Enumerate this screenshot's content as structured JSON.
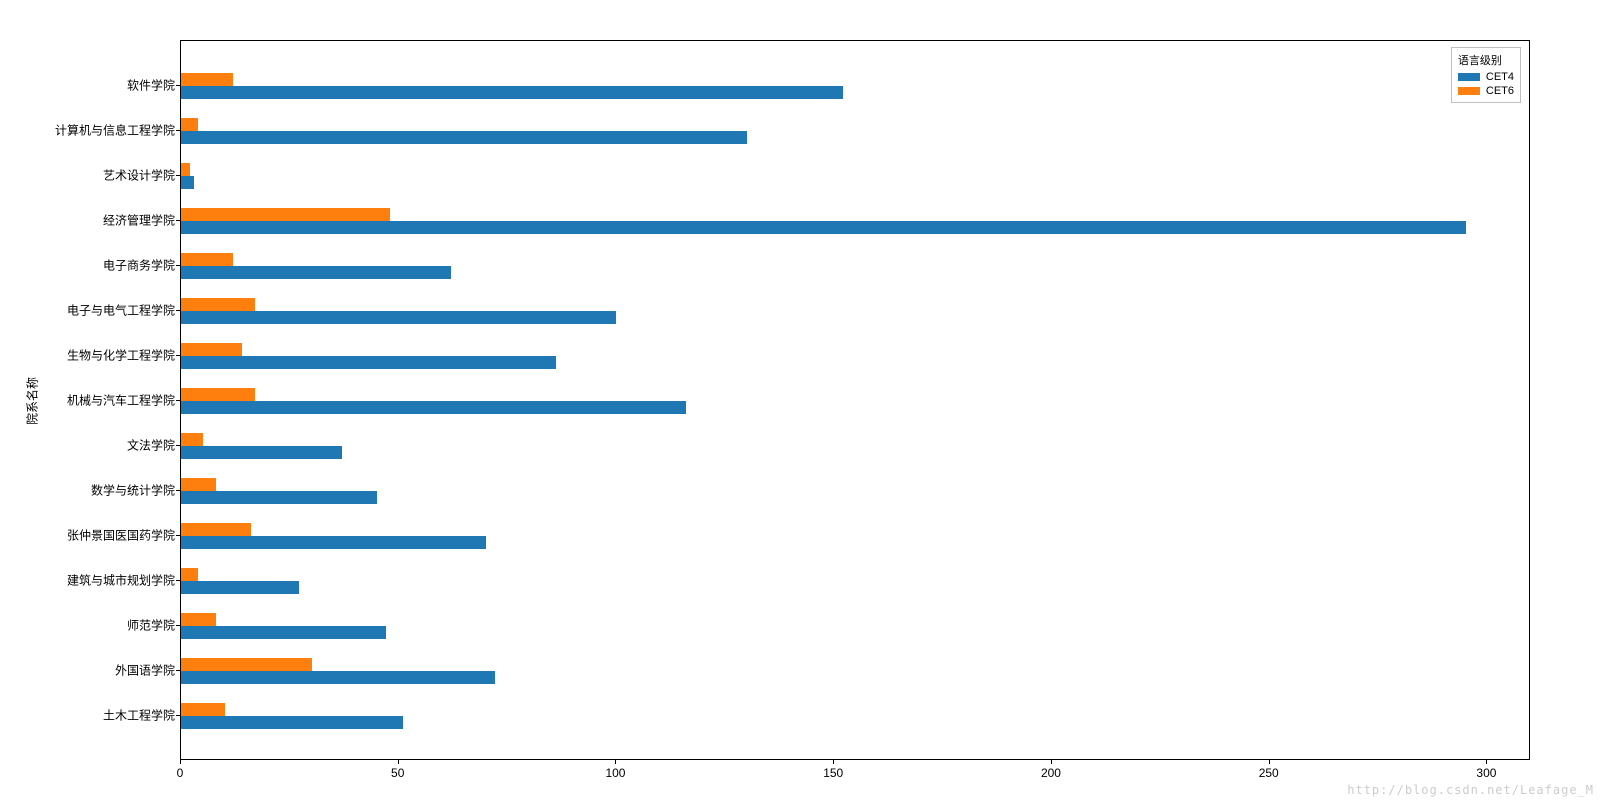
{
  "chart_data": {
    "type": "bar",
    "orientation": "horizontal",
    "ylabel": "院系名称",
    "xlabel": "",
    "xlim": [
      0,
      310
    ],
    "x_ticks": [
      0,
      50,
      100,
      150,
      200,
      250,
      300
    ],
    "legend_title": "语言级别",
    "categories": [
      "软件学院",
      "计算机与信息工程学院",
      "艺术设计学院",
      "经济管理学院",
      "电子商务学院",
      "电子与电气工程学院",
      "生物与化学工程学院",
      "机械与汽车工程学院",
      "文法学院",
      "数学与统计学院",
      "张仲景国医国药学院",
      "建筑与城市规划学院",
      "师范学院",
      "外国语学院",
      "土木工程学院"
    ],
    "series": [
      {
        "name": "CET4",
        "color": "#1f77b4",
        "values": [
          152,
          130,
          3,
          295,
          62,
          100,
          86,
          116,
          37,
          45,
          70,
          27,
          47,
          72,
          51
        ]
      },
      {
        "name": "CET6",
        "color": "#ff7f0e",
        "values": [
          12,
          4,
          2,
          48,
          12,
          17,
          14,
          17,
          5,
          8,
          16,
          4,
          8,
          30,
          10
        ]
      }
    ]
  },
  "watermark": "http://blog.csdn.net/Leafage_M"
}
